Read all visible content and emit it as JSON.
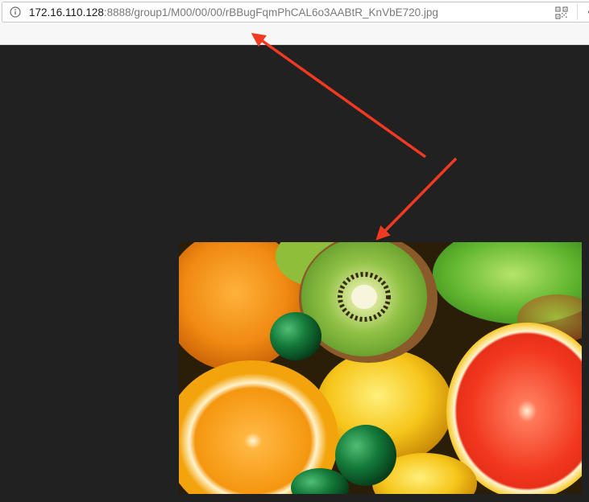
{
  "address_bar": {
    "info_icon": "info-icon",
    "url_host": "172.16.110.128",
    "url_path": ":8888/group1/M00/00/00/rBBugFqmPhCAL6o3AABtR_KnVbE720.jpg",
    "qr_icon": "qr-code-icon",
    "more_icon": "more-dots-icon"
  },
  "viewer": {
    "background": "#212121",
    "image": {
      "subject": "fruit-photo"
    }
  },
  "annotations": {
    "arrow_color": "#f23a22"
  }
}
